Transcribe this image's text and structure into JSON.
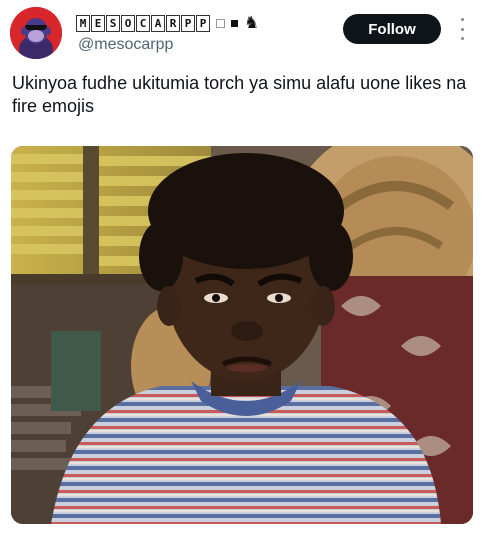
{
  "author": {
    "display_name_letters": [
      "M",
      "E",
      "S",
      "O",
      "C",
      "A",
      "R",
      "P",
      "P"
    ],
    "handle": "@mesocarpp",
    "avatar_icon": "ape-avatar",
    "badge_icons": [
      "outline-square-icon",
      "filled-square-icon",
      "goat-icon"
    ]
  },
  "follow_label": "Follow",
  "tweet_text": "Ukinyoa fudhe ukitumia torch ya simu alafu uone likes na fire emojis",
  "media": {
    "kind": "photo",
    "icon": "meme-photo"
  },
  "colors": {
    "avatar_bg": "#d8262a",
    "follow_bg": "#0f1419",
    "handle": "#536471"
  }
}
